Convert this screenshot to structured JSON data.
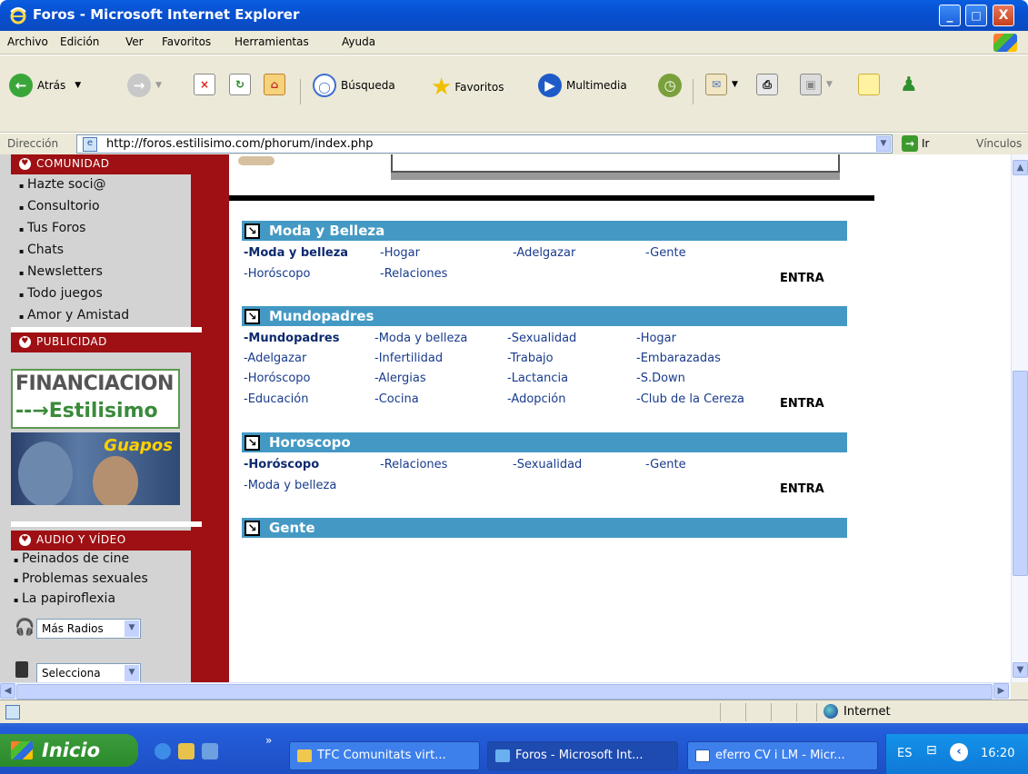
{
  "window": {
    "title": "Foros - Microsoft Internet Explorer",
    "controls": [
      "_",
      "□",
      "X"
    ]
  },
  "menu": [
    "Archivo",
    "Edición",
    "Ver",
    "Favoritos",
    "Herramientas",
    "Ayuda"
  ],
  "toolbar": {
    "back": "Atrás",
    "search": "Búsqueda",
    "favorites": "Favoritos",
    "media": "Multimedia"
  },
  "address": {
    "label": "Dirección",
    "url": "http://foros.estilisimo.com/phorum/index.php",
    "go": "Ir",
    "links": "Vínculos"
  },
  "sidebar": {
    "comunidad": {
      "title": "COMUNIDAD",
      "items": [
        "Hazte soci@",
        "Consultorio",
        "Tus Foros",
        "Chats",
        "Newsletters",
        "Todo juegos",
        "Amor y Amistad"
      ]
    },
    "publicidad": {
      "title": "PUBLICIDAD",
      "ad1_line1": "FINANCIACION",
      "ad1_line2": "--→Estilisimo",
      "ad2": "Guapos"
    },
    "audio": {
      "title": "AUDIO Y VÍDEO",
      "items": [
        "Peinados de cine",
        "Problemas sexuales",
        "La papiroflexia"
      ]
    },
    "radio_select": "Más Radios",
    "other_select": "Selecciona"
  },
  "forums": [
    {
      "title": "Moda y Belleza",
      "rows": [
        [
          "Moda y belleza",
          "-Hogar",
          "-Adelgazar",
          "-Gente"
        ],
        [
          "-Horóscopo",
          "-Relaciones"
        ]
      ],
      "enter": "ENTRA"
    },
    {
      "title": "Mundopadres",
      "rows": [
        [
          "-Mundopadres",
          "-Moda y belleza",
          "-Sexualidad",
          "-Hogar"
        ],
        [
          "-Adelgazar",
          "-Infertilidad",
          "-Trabajo",
          "-Embarazadas"
        ],
        [
          "-Horóscopo",
          "-Alergias",
          "-Lactancia",
          "-S.Down"
        ],
        [
          "-Educación",
          "-Cocina",
          "-Adopción",
          "-Club de la Cereza"
        ]
      ],
      "enter": "ENTRA"
    },
    {
      "title": "Horoscopo",
      "rows": [
        [
          "-Horóscopo",
          "-Relaciones",
          "-Sexualidad",
          "-Gente"
        ],
        [
          "-Moda y belleza"
        ]
      ],
      "enter": "ENTRA"
    },
    {
      "title": "Gente"
    }
  ],
  "status": {
    "zone": "Internet"
  },
  "taskbar": {
    "start": "Inicio",
    "tasks": [
      "TFC Comunitats virt...",
      "Foros - Microsoft Int...",
      "eferro CV i LM - Micr..."
    ],
    "lang": "ES",
    "time": "16:20"
  },
  "colors": {
    "sidebar_red": "#9e1013",
    "forum_header": "#4499c4",
    "link": "#183b8c",
    "title_bar": "#0751d2"
  }
}
